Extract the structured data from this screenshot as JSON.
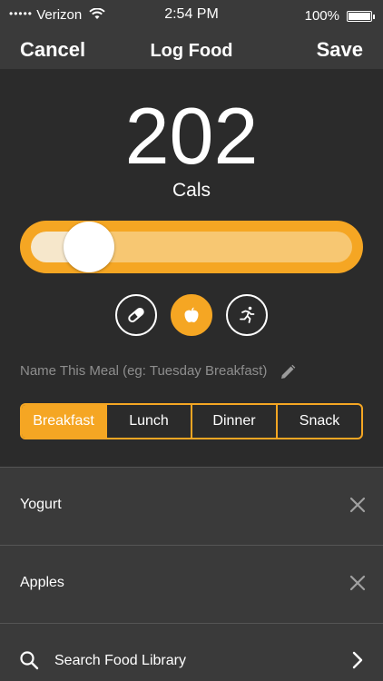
{
  "status_bar": {
    "signal_dots": "•••••",
    "carrier": "Verizon",
    "time": "2:54 PM",
    "battery": "100%"
  },
  "nav": {
    "cancel_label": "Cancel",
    "title": "Log Food",
    "save_label": "Save"
  },
  "calories": {
    "value": "202",
    "unit": "Cals",
    "slider_fraction": 0.18
  },
  "modes": [
    {
      "name": "pill-icon",
      "active": false
    },
    {
      "name": "apple-icon",
      "active": true
    },
    {
      "name": "running-icon",
      "active": false
    }
  ],
  "meal": {
    "placeholder": "Name This Meal (eg: Tuesday Breakfast)"
  },
  "meal_types": [
    {
      "label": "Breakfast",
      "active": true
    },
    {
      "label": "Lunch",
      "active": false
    },
    {
      "label": "Dinner",
      "active": false
    },
    {
      "label": "Snack",
      "active": false
    }
  ],
  "food_items": [
    {
      "label": "Yogurt"
    },
    {
      "label": "Apples"
    }
  ],
  "search": {
    "label": "Search Food Library"
  },
  "colors": {
    "accent": "#f5a623",
    "background": "#2b2b2b",
    "panel": "#3a3a3a"
  }
}
